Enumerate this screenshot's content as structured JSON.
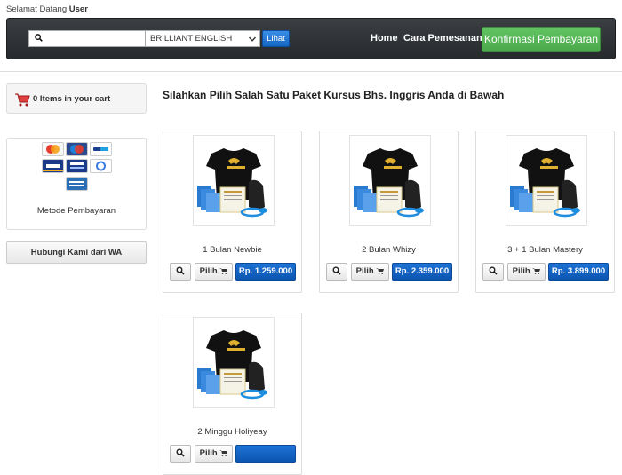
{
  "header": {
    "greeting_prefix": "Selamat Datang",
    "greeting_user": "User"
  },
  "nav": {
    "search": {
      "value": "",
      "placeholder": ""
    },
    "category_select": "BRILLIANT ENGLISH",
    "search_button": "Lihat",
    "links": [
      "Home",
      "Cara Pemesanan"
    ],
    "confirm_button": "Konfirmasi Pembayaran"
  },
  "sidebar": {
    "cart_label": "0 Items in your cart",
    "payment_label": "Metode Pembayaran",
    "payment_cards": [
      {
        "name": "MasterCard",
        "color": "#f7f7f7"
      },
      {
        "name": "Maestro",
        "color": "#2a4b8d"
      },
      {
        "name": "PayPal",
        "color": "#ffffff"
      },
      {
        "name": "VISA",
        "color": "#1a3a8a"
      },
      {
        "name": "VISA Electron",
        "color": "#1a3a8a"
      },
      {
        "name": "Google Checkout",
        "color": "#ffffff"
      },
      {
        "name": "American Express",
        "color": "#2b6fb6"
      }
    ],
    "wa_button": "Hubungi Kami dari WA"
  },
  "main": {
    "heading": "Silahkan Pilih Salah Satu Paket Kursus Bhs. Inggris Anda di Bawah",
    "products": [
      {
        "name": "1 Bulan Newbie",
        "pilih": "Pilih",
        "price": "Rp. 1.259.000"
      },
      {
        "name": "2 Bulan Whizy",
        "pilih": "Pilih",
        "price": "Rp. 2.359.000"
      },
      {
        "name": "3 + 1 Bulan Mastery",
        "pilih": "Pilih",
        "price": "Rp. 3.899.000"
      },
      {
        "name": "2 Minggu Holiyeay",
        "pilih": "Pilih",
        "price": ""
      }
    ]
  },
  "colors": {
    "navbar": "#2e3236",
    "accent_green": "#55b655",
    "accent_blue": "#0f62c4"
  }
}
